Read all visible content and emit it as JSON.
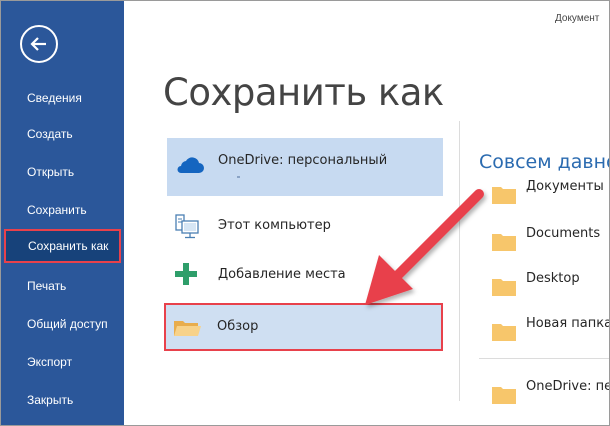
{
  "window": {
    "document_title": "Документ"
  },
  "sidebar": {
    "back_label": "",
    "items": [
      {
        "label": "Сведения"
      },
      {
        "label": "Создать"
      },
      {
        "label": "Открыть"
      },
      {
        "label": "Сохранить"
      },
      {
        "label": "Сохранить как",
        "active": true
      },
      {
        "label": "Печать"
      },
      {
        "label": "Общий доступ"
      },
      {
        "label": "Экспорт"
      },
      {
        "label": "Закрыть"
      }
    ]
  },
  "main": {
    "title": "Сохранить как",
    "locations": [
      {
        "label": "OneDrive: персональный",
        "icon": "cloud-icon",
        "selected": true
      },
      {
        "label": "Этот компьютер",
        "icon": "computer-icon"
      },
      {
        "label": "Добавление места",
        "icon": "plus-icon"
      },
      {
        "label": "Обзор",
        "icon": "folder-icon",
        "highlighted": true
      }
    ],
    "recent": {
      "title": "Совсем давно",
      "items": [
        {
          "label": "Документы"
        },
        {
          "label": "Documents"
        },
        {
          "label": "Desktop"
        },
        {
          "label": "Новая папка"
        },
        {
          "label": "OneDrive: пе"
        }
      ]
    }
  },
  "colors": {
    "sidebar": "#2b579a",
    "accent_red": "#e8414b",
    "selection": "#c7daf1",
    "recent_title": "#2b6bb0",
    "folder": "#f7c66b"
  }
}
